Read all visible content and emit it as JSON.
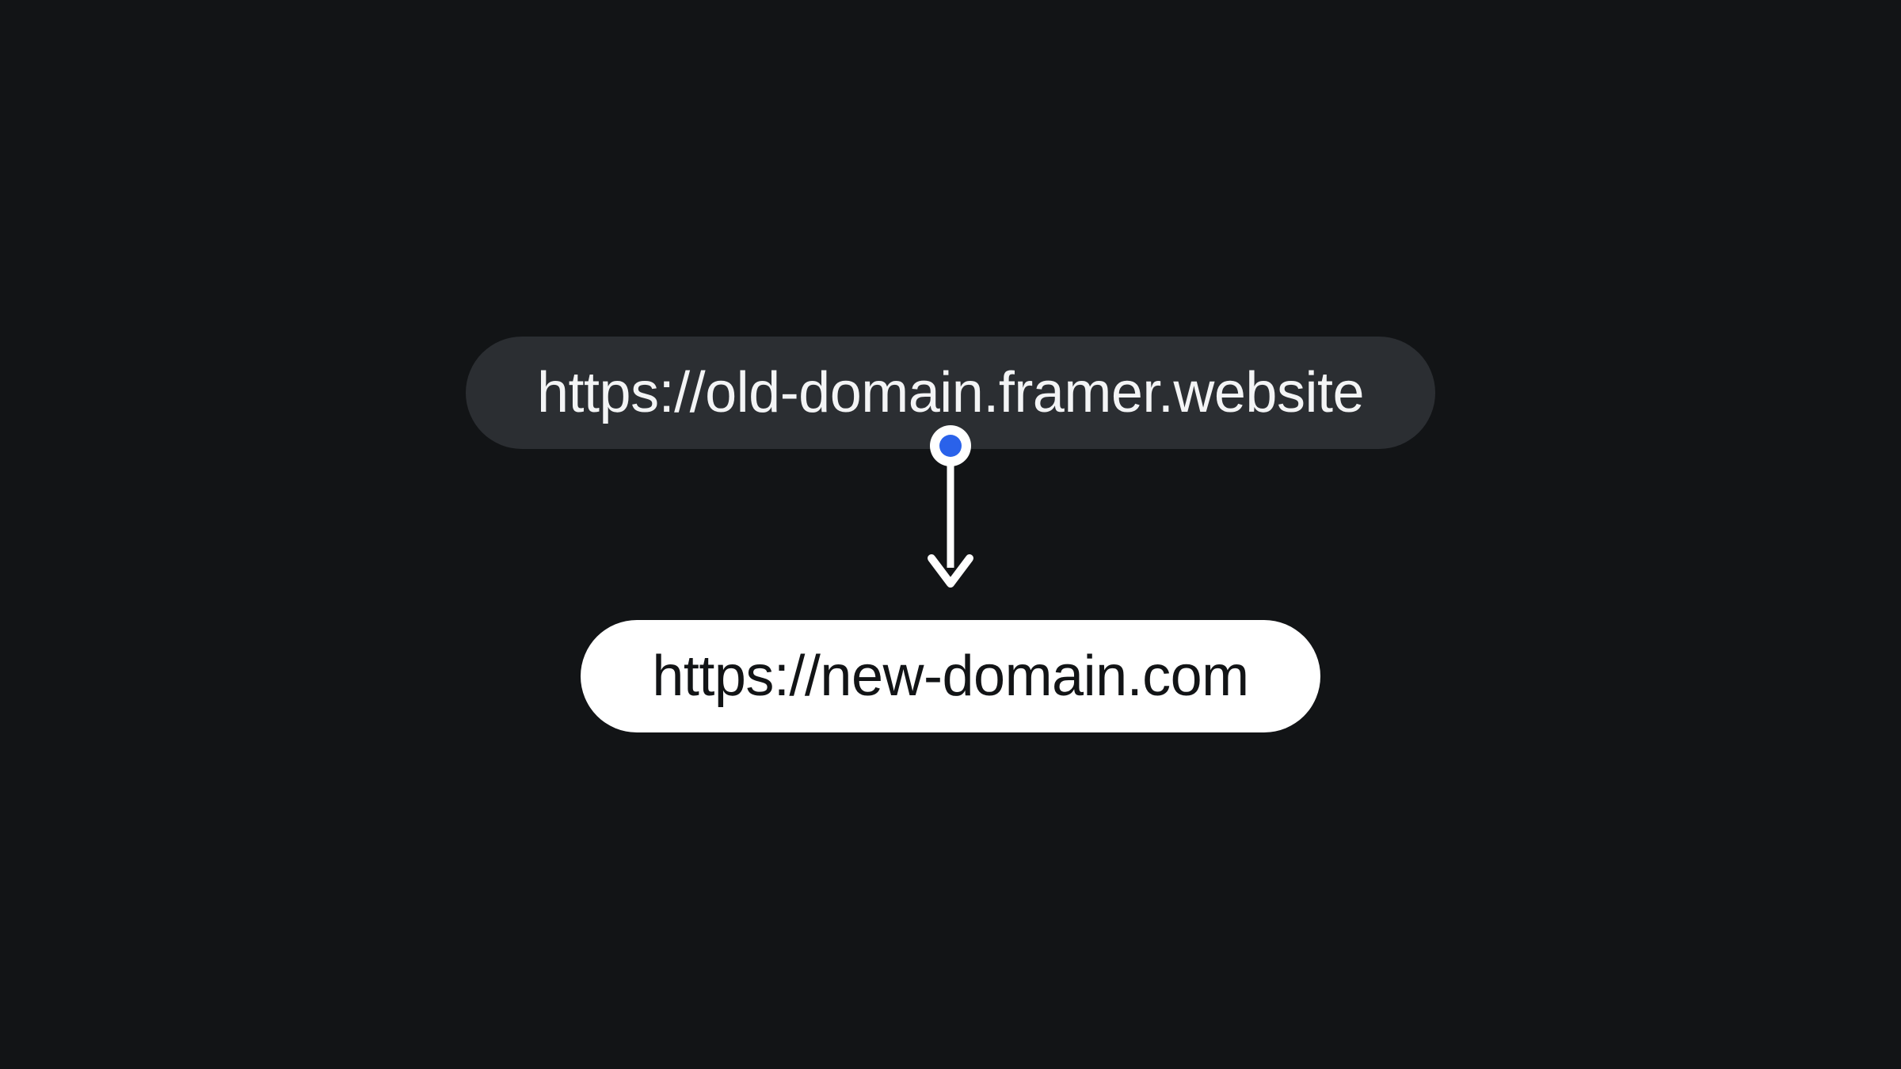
{
  "diagram": {
    "old_domain": "https://old-domain.framer.website",
    "new_domain": "https://new-domain.com"
  },
  "colors": {
    "background": "#121416",
    "pill_old_bg": "#2b2e32",
    "pill_old_text": "#f3f4f5",
    "pill_new_bg": "#ffffff",
    "pill_new_text": "#121416",
    "node_outer": "#ffffff",
    "node_inner": "#2a62ea",
    "arrow": "#ffffff"
  }
}
